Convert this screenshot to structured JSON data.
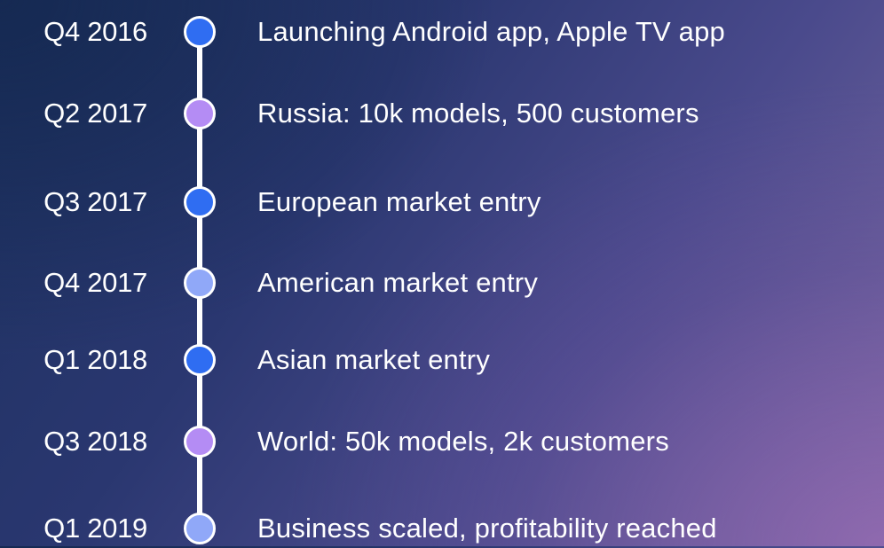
{
  "colors": {
    "dot_blue": "#2f6df2",
    "dot_purple": "#b48cf4",
    "dot_lightblue": "#90a8f8",
    "line": "#ffffff",
    "text": "#ffffff"
  },
  "milestones": [
    {
      "date": "Q4 2016",
      "text": "Launching Android app, Apple TV app",
      "dot_color": "blue"
    },
    {
      "date": "Q2 2017",
      "text": "Russia: 10k models, 500 customers",
      "dot_color": "purple"
    },
    {
      "date": "Q3 2017",
      "text": "European market entry",
      "dot_color": "blue"
    },
    {
      "date": "Q4 2017",
      "text": "American market entry",
      "dot_color": "lightblue"
    },
    {
      "date": "Q1 2018",
      "text": "Asian market entry",
      "dot_color": "blue"
    },
    {
      "date": "Q3 2018",
      "text": "World: 50k models, 2k customers",
      "dot_color": "purple"
    },
    {
      "date": "Q1 2019",
      "text": "Business scaled, profitability reached",
      "dot_color": "lightblue"
    }
  ]
}
